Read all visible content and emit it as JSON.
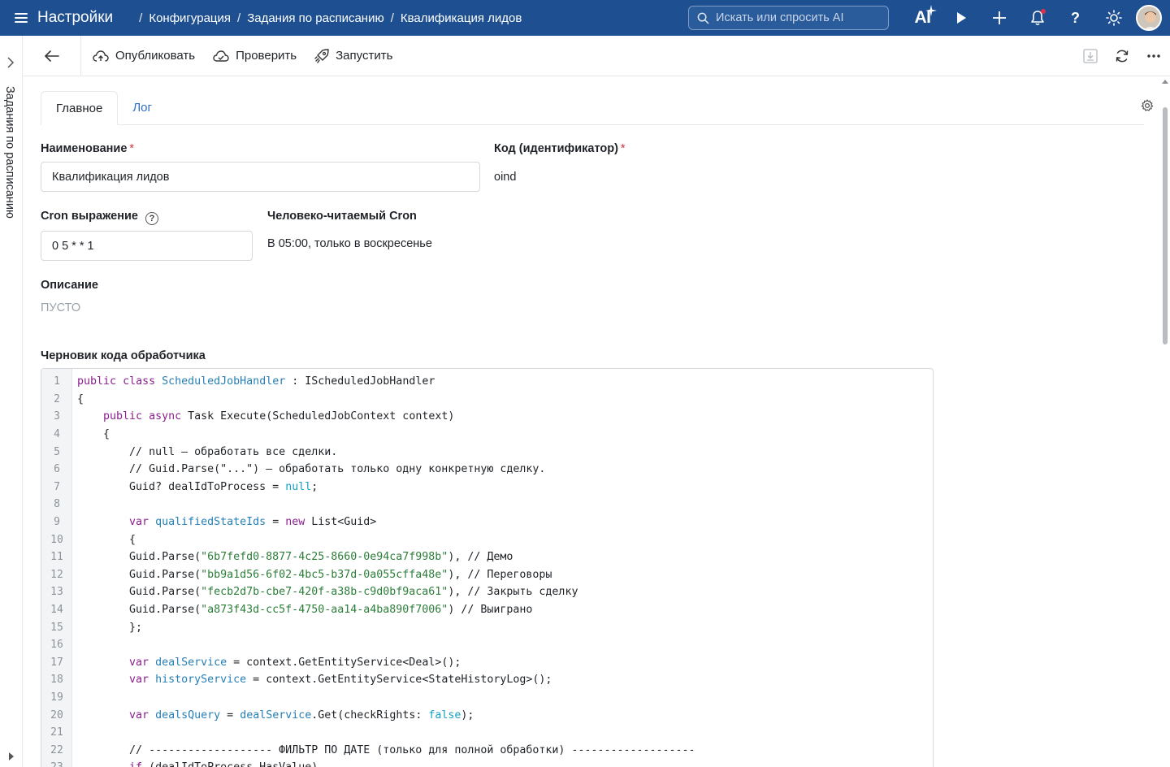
{
  "header": {
    "app_title": "Настройки",
    "breadcrumbs": [
      "Конфигурация",
      "Задания по расписанию",
      "Квалификация лидов"
    ],
    "search_placeholder": "Искать или спросить AI",
    "ai_label": "AI"
  },
  "rail": {
    "label": "Задания по расписанию"
  },
  "toolbar": {
    "publish_label": "Опубликовать",
    "check_label": "Проверить",
    "run_label": "Запустить"
  },
  "tabs": [
    {
      "label": "Главное",
      "active": true
    },
    {
      "label": "Лог",
      "active": false
    }
  ],
  "form": {
    "name_label": "Наименование",
    "name_value": "Квалификация лидов",
    "code_label": "Код (идентификатор)",
    "code_value": "oind",
    "cron_label": "Cron выражение",
    "cron_value": "0 5 * * 1",
    "human_cron_label": "Человеко-читаемый Cron",
    "human_cron_value": "В 05:00, только в воскресенье",
    "description_label": "Описание",
    "description_value": "ПУСТО",
    "code_draft_label": "Черновик кода обработчика"
  },
  "code": {
    "lines": [
      "public class ScheduledJobHandler : IScheduledJobHandler",
      "{",
      "    public async Task Execute(ScheduledJobContext context)",
      "    {",
      "        // null — обработать все сделки.",
      "        // Guid.Parse(\"...\") — обработать только одну конкретную сделку.",
      "        Guid? dealIdToProcess = null;",
      "",
      "        var qualifiedStateIds = new List<Guid>",
      "        {",
      "        Guid.Parse(\"6b7fefd0-8877-4c25-8660-0e94ca7f998b\"), // Демо",
      "        Guid.Parse(\"bb9a1d56-6f02-4bc5-b37d-0a055cffa48e\"), // Переговоры",
      "        Guid.Parse(\"fecb2d7b-cbe7-420f-a38b-c9d0bf9aca61\"), // Закрыть сделку",
      "        Guid.Parse(\"a873f43d-cc5f-4750-aa14-a4ba890f7006\") // Выиграно",
      "        };",
      "",
      "        var dealService = context.GetEntityService<Deal>();",
      "        var historyService = context.GetEntityService<StateHistoryLog>();",
      "",
      "        var dealsQuery = dealService.Get(checkRights: false);",
      "",
      "        // ------------------- ФИЛЬТР ПО ДАТЕ (только для полной обработки) -------------------",
      "        if (dealIdToProcess.HasValue)"
    ]
  },
  "colors": {
    "header_bg": "#1d4f91",
    "link": "#2f6fc4",
    "required": "#d13438",
    "keyword": "#8b1f8f",
    "type": "#267fb5",
    "string": "#2d7d3a",
    "literal": "#14a0c0"
  }
}
